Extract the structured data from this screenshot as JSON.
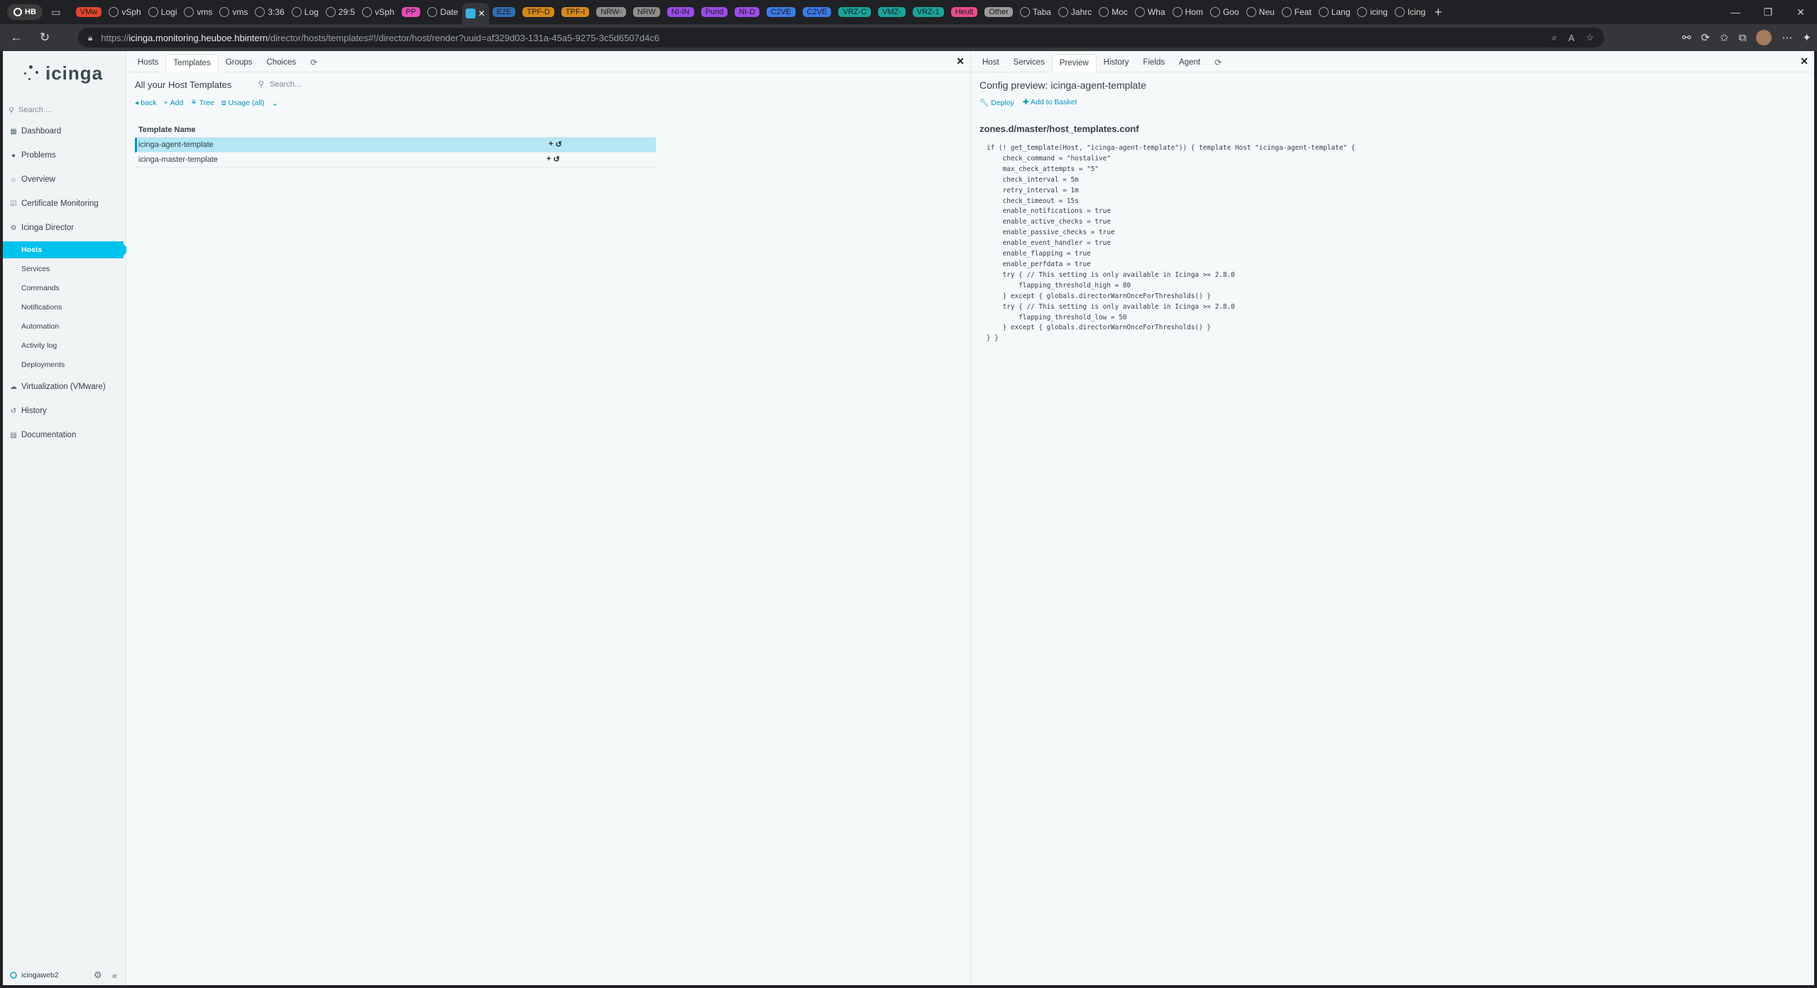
{
  "browser": {
    "profile_label": "HB",
    "tabs": [
      {
        "label": "VMw",
        "chip": "#e2462d"
      },
      {
        "label": "vSph"
      },
      {
        "label": "Logi"
      },
      {
        "label": "vms"
      },
      {
        "label": "vms"
      },
      {
        "label": "3:36"
      },
      {
        "label": "Log"
      },
      {
        "label": "29:5"
      },
      {
        "label": "vSph"
      },
      {
        "label": "PP",
        "chip": "#e84cba"
      },
      {
        "label": "Date"
      },
      {
        "label": "E2E",
        "chip": "#2f6fb8"
      },
      {
        "label": "TPF-D",
        "chip": "#d6891a"
      },
      {
        "label": "TPF-I",
        "chip": "#d6891a"
      },
      {
        "label": "NRW-",
        "chip": "#8e8e8e"
      },
      {
        "label": "NRW",
        "chip": "#8e8e8e"
      },
      {
        "label": "NI-IN",
        "chip": "#9b4ce8"
      },
      {
        "label": "Pund",
        "chip": "#9b4ce8"
      },
      {
        "label": "NI-D",
        "chip": "#9b4ce8"
      },
      {
        "label": "C2VE",
        "chip": "#3b7be8"
      },
      {
        "label": "C2VE",
        "chip": "#3b7be8"
      },
      {
        "label": "VRZ-C",
        "chip": "#1aa39c"
      },
      {
        "label": "VMZ-",
        "chip": "#1aa39c"
      },
      {
        "label": "VRZ-1",
        "chip": "#1aa39c"
      },
      {
        "label": "Heult",
        "chip": "#e84c8a"
      },
      {
        "label": "Other",
        "chip": "#9a9a9a"
      },
      {
        "label": "Taba"
      },
      {
        "label": "Jahrc"
      },
      {
        "label": "Moc"
      },
      {
        "label": "Wha"
      },
      {
        "label": "Hom"
      },
      {
        "label": "Goo"
      },
      {
        "label": "Neu"
      },
      {
        "label": "Feat"
      },
      {
        "label": "Lang"
      },
      {
        "label": "icing"
      },
      {
        "label": "Icing"
      }
    ],
    "url_prefix": "https://",
    "url_host": "icinga.monitoring.heuboe.hbintern",
    "url_path": "/director/hosts/templates#!/director/host/render?uuid=af329d03-131a-45a5-9275-3c5d6507d4c6"
  },
  "sidebar": {
    "search_placeholder": "Search ...",
    "items": [
      {
        "label": "Dashboard",
        "icon": "dashboard-icon"
      },
      {
        "label": "Problems",
        "icon": "problems-icon"
      },
      {
        "label": "Overview",
        "icon": "overview-icon"
      },
      {
        "label": "Certificate Monitoring",
        "icon": "certificate-icon"
      },
      {
        "label": "Icinga Director",
        "icon": "director-icon"
      }
    ],
    "director_sub": [
      "Hosts",
      "Services",
      "Commands",
      "Notifications",
      "Automation",
      "Activity log",
      "Deployments"
    ],
    "items_after": [
      {
        "label": "Virtualization (VMware)",
        "icon": "cloud-icon"
      },
      {
        "label": "History",
        "icon": "history-icon"
      },
      {
        "label": "Documentation",
        "icon": "documentation-icon"
      }
    ],
    "footer_user": "icingaweb2"
  },
  "left": {
    "tabs": [
      "Hosts",
      "Templates",
      "Groups",
      "Choices"
    ],
    "active_tab": "Templates",
    "title": "All your Host Templates",
    "search_placeholder": "Search...",
    "actions": [
      "back",
      "Add",
      "Tree",
      "Usage (all)"
    ],
    "table_header": "Template Name",
    "rows": [
      "icinga-agent-template",
      "icinga-master-template"
    ]
  },
  "right": {
    "tabs": [
      "Host",
      "Services",
      "Preview",
      "History",
      "Fields",
      "Agent"
    ],
    "active_tab": "Preview",
    "title": "Config preview: icinga-agent-template",
    "actions": [
      "Deploy",
      "Add to Basket"
    ],
    "file": "zones.d/master/host_templates.conf",
    "config_lines": [
      "if (! get_template(Host, \"icinga-agent-template\")) { template Host \"icinga-agent-template\" {",
      "    check_command = \"hostalive\"",
      "    max_check_attempts = \"5\"",
      "    check_interval = 5m",
      "    retry_interval = 1m",
      "    check_timeout = 15s",
      "    enable_notifications = true",
      "    enable_active_checks = true",
      "    enable_passive_checks = true",
      "    enable_event_handler = true",
      "    enable_flapping = true",
      "    enable_perfdata = true",
      "    try { // This setting is only available in Icinga >= 2.8.0",
      "        flapping_threshold_high = 80",
      "    } except { globals.directorWarnOnceForThresholds() }",
      "    try { // This setting is only available in Icinga >= 2.8.0",
      "        flapping_threshold_low = 50",
      "    } except { globals.directorWarnOnceForThresholds() }",
      "} }"
    ]
  },
  "colors": {
    "accent": "#00c3ed",
    "link": "#0095bf",
    "selected_row": "#b4e6f5"
  }
}
